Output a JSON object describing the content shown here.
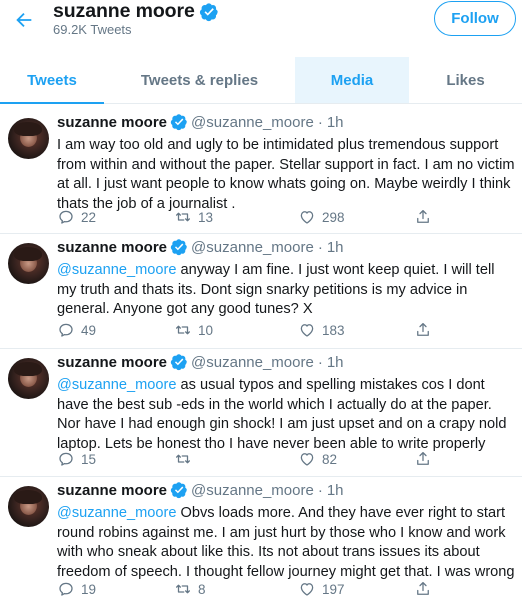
{
  "header": {
    "name": "suzanne moore",
    "tweet_count": "69.2K Tweets",
    "follow_label": "Follow"
  },
  "tabs": [
    {
      "label": "Tweets",
      "state": "active"
    },
    {
      "label": "Tweets & replies",
      "state": "normal"
    },
    {
      "label": "Media",
      "state": "hover"
    },
    {
      "label": "Likes",
      "state": "normal"
    }
  ],
  "colors": {
    "accent": "#1da1f2",
    "muted": "#657786",
    "text": "#14171a",
    "divider": "#e6ecf0"
  },
  "tweets": [
    {
      "name": "suzanne moore",
      "handle": "@suzanne_moore",
      "dot": "·",
      "time": "1h",
      "mention": "",
      "text": "I am way too old and ugly to be intimidated plus tremendous support from within and without the paper. Stellar support in fact. I am no victim at all. I just want people to know whats going on. Maybe weirdly I think thats the job of a journalist .",
      "replies": "22",
      "retweets": "13",
      "likes": "298"
    },
    {
      "name": "suzanne moore",
      "handle": "@suzanne_moore",
      "dot": "·",
      "time": "1h",
      "mention": "@suzanne_moore",
      "text": " anyway I am fine. I just wont keep quiet. I will tell my truth  and thats its. Dont sign snarky petitions is my advice in general. Anyone got any good tunes?  X",
      "replies": "49",
      "retweets": "10",
      "likes": "183"
    },
    {
      "name": "suzanne moore",
      "handle": "@suzanne_moore",
      "dot": "·",
      "time": "1h",
      "mention": "@suzanne_moore",
      "text": " as usual typos and spelling mistakes cos I dont have the best sub -eds in the world which I actually do at the paper.  Nor have I had enough gin shock!  I am just upset and on a crapy nold laptop. Lets be honest tho I have never been able to write properly",
      "replies": "15",
      "retweets": "",
      "likes": "82"
    },
    {
      "name": "suzanne moore",
      "handle": "@suzanne_moore",
      "dot": "·",
      "time": "1h",
      "mention": "@suzanne_moore",
      "text": " Obvs loads more. And they have ever right to start round robins against me. I am just hurt by those who I know and work with who sneak about like this. Its not about trans issues  its about freedom of speech. I thought fellow journey might get that.  I was wrong",
      "replies": "19",
      "retweets": "8",
      "likes": "197"
    }
  ],
  "icons": [
    "back-arrow-icon",
    "verified-badge-icon",
    "reply-icon",
    "retweet-icon",
    "like-icon",
    "share-icon"
  ]
}
